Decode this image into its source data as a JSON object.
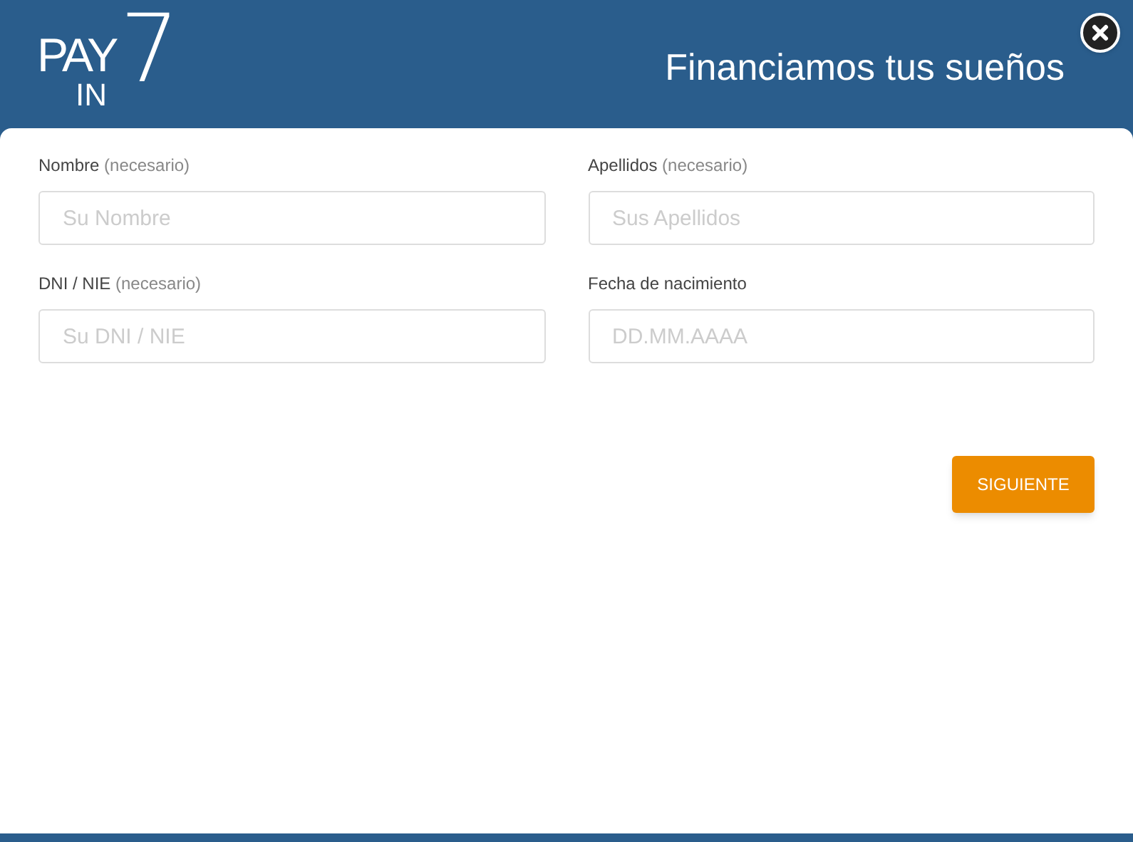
{
  "logo": {
    "top": "PAY",
    "bottom": "IN",
    "numeral": "7"
  },
  "header": {
    "title": "Financiamos tus sueños"
  },
  "fields": [
    {
      "label": "Nombre",
      "hint": "(necesario)",
      "placeholder": "Su Nombre"
    },
    {
      "label": "Apellidos",
      "hint": "(necesario)",
      "placeholder": "Sus Apellidos"
    },
    {
      "label": "DNI / NIE",
      "hint": "(necesario)",
      "placeholder": "Su DNI / NIE"
    },
    {
      "label": "Fecha de nacimiento",
      "placeholder": "DD.MM.AAAA"
    }
  ],
  "button": {
    "label": "SIGUIENTE"
  }
}
